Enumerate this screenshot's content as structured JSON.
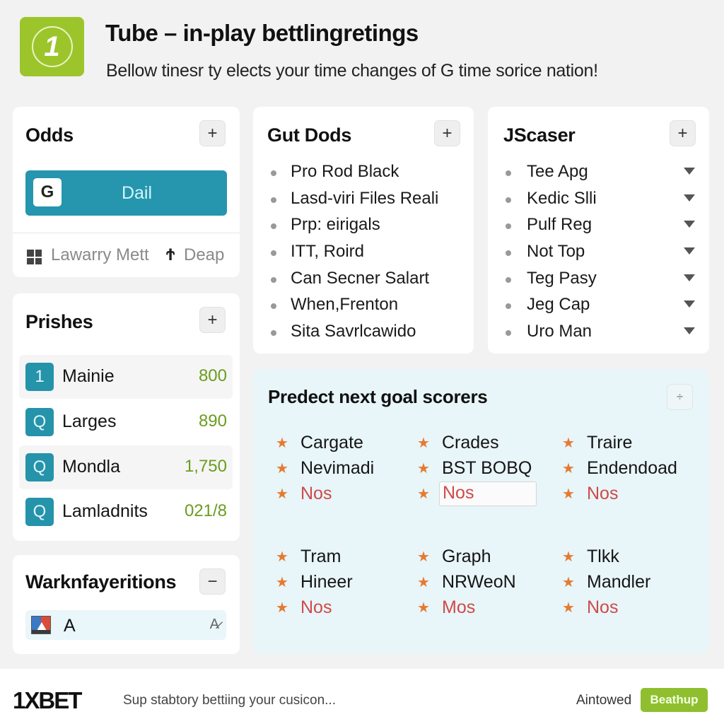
{
  "header": {
    "logo_glyph": "1",
    "title": "Tube – in-play bettlingretings",
    "subtitle": "Bellow tinesr ty elects your time changes of G time sorice nation!"
  },
  "odds": {
    "title": "Odds",
    "add_icon": "+",
    "dial_button": {
      "icon": "G",
      "label": "Dail"
    },
    "footer": {
      "link1": "Lawarry Mett",
      "link2_icon": "Ϯ",
      "link2": "Deap"
    }
  },
  "prishes": {
    "title": "Prishes",
    "add_icon": "+",
    "rows": [
      {
        "badge": "1",
        "name": "Mainie",
        "amount": "800"
      },
      {
        "badge": "Q",
        "name": "Larges",
        "amount": "890"
      },
      {
        "badge": "Q",
        "name": "Mondla",
        "amount": "1,750"
      },
      {
        "badge": "Q",
        "name": "Lamladnits",
        "amount": "021/8"
      }
    ]
  },
  "warkn": {
    "title": "Warknfayeritions",
    "collapse_icon": "−",
    "row": {
      "value": "A",
      "edit_icon": "A̷"
    }
  },
  "gut_dods": {
    "title": "Gut Dods",
    "add_icon": "+",
    "items": [
      "Pro Rod Black",
      "Lasd-viri Files Reali",
      "Prp: eirigals",
      "ITT, Roird",
      "Can Secner Salart",
      "When,Frenton",
      "Sita Savrlcawido"
    ]
  },
  "jscaser": {
    "title": "JScaser",
    "add_icon": "+",
    "items": [
      "Tee Apg",
      "Kedic Slli",
      "Pulf Reg",
      "Not Top",
      "Teg Pasy",
      "Jeg Cap",
      "Uro Man"
    ]
  },
  "predict": {
    "title": "Predect next goal scorers",
    "options_icon": "÷",
    "star_icon": "★",
    "groups": [
      {
        "columns": [
          [
            "Cargate",
            "Nevimadi",
            "Nos"
          ],
          [
            "Crades",
            "BST BOBQ",
            "Nos"
          ],
          [
            "Traire",
            "Endendoad",
            "Nos"
          ]
        ]
      },
      {
        "columns": [
          [
            "Tram",
            "Hineer",
            "Nos"
          ],
          [
            "Graph",
            "NRWeoN",
            "Mos"
          ],
          [
            "Tlkk",
            "Mandler",
            "Nos"
          ]
        ]
      }
    ]
  },
  "bottombar": {
    "brand": "1XBET",
    "tagline": "Sup stabtory bettiing your cusicon...",
    "link": "Aintowed",
    "button": "Beathup"
  },
  "colors": {
    "brand_green": "#9cc52c",
    "teal": "#2596ad",
    "amount_green": "#6a9d1f",
    "star_orange": "#e67a30",
    "nos_red": "#cf4a47"
  }
}
